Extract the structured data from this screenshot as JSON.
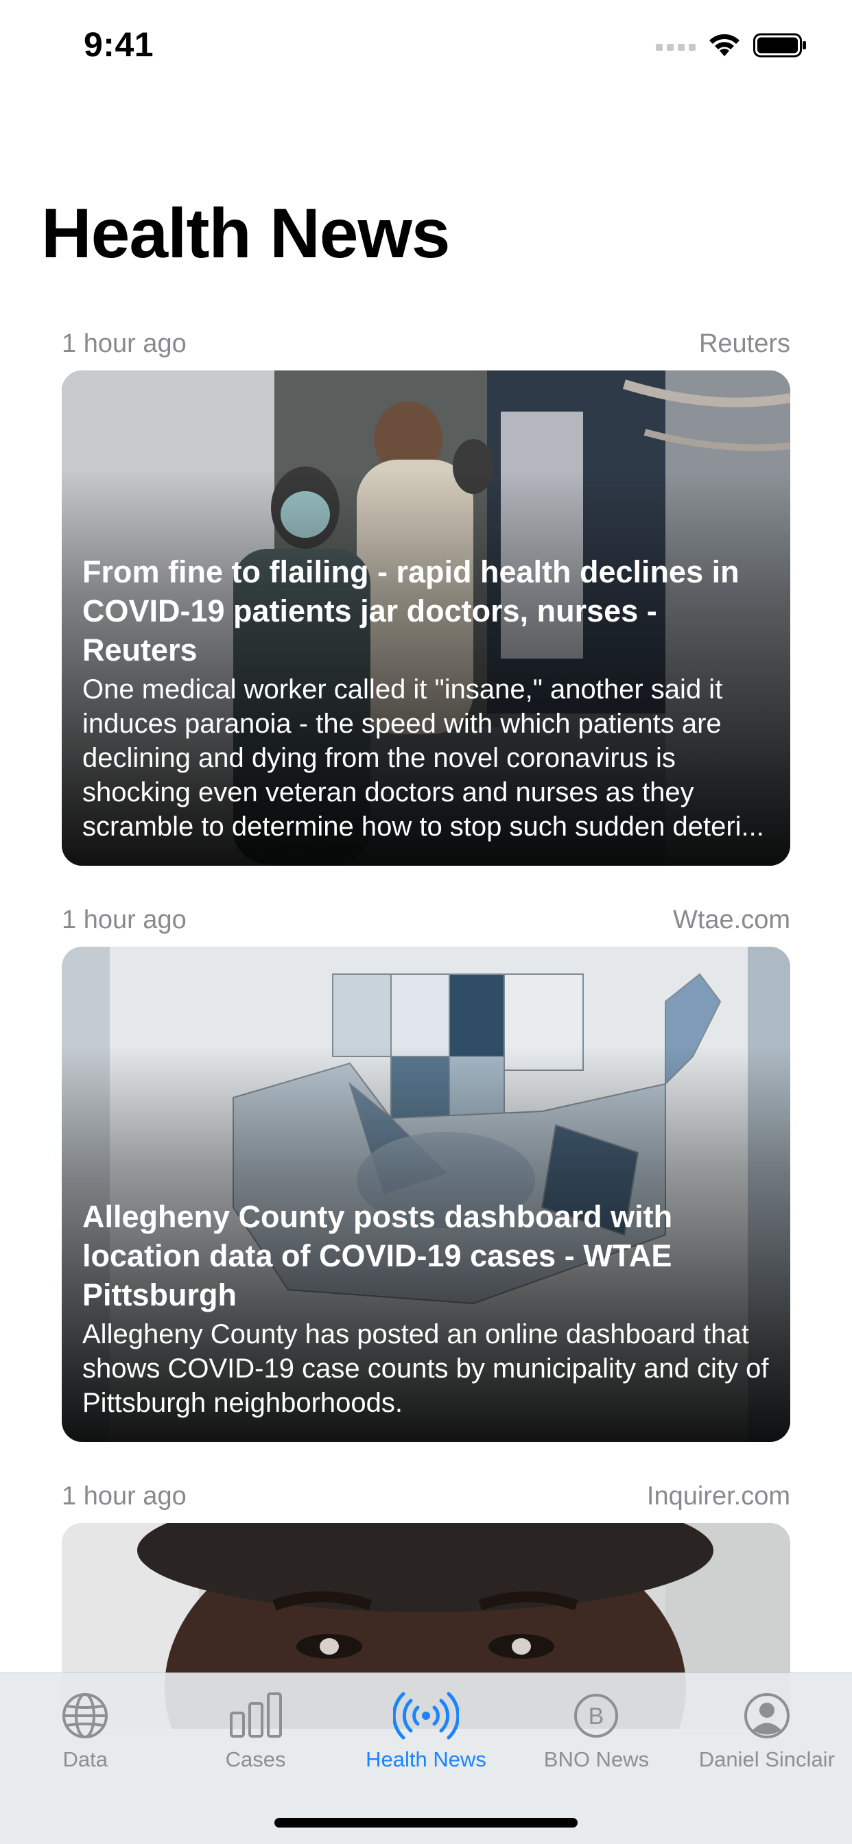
{
  "status_bar": {
    "time": "9:41"
  },
  "page": {
    "title": "Health News"
  },
  "articles": [
    {
      "time_ago": "1 hour ago",
      "source": "Reuters",
      "headline": "From fine to flailing - rapid health declines in COVID-19 patients jar doctors, nurses - Reuters",
      "summary": "One medical worker called it \"insane,\" another said it induces paranoia - the speed with which patients are declining and dying from the novel coronavirus is shocking even veteran doctors and nurses as they scramble to determine how to stop such sudden deteri..."
    },
    {
      "time_ago": "1 hour ago",
      "source": "Wtae.com",
      "headline": "Allegheny County posts dashboard with location data of COVID-19 cases - WTAE Pittsburgh",
      "summary": "Allegheny County has posted an online dashboard that shows COVID-19 case counts by municipality and city of Pittsburgh neighborhoods."
    },
    {
      "time_ago": "1 hour ago",
      "source": "Inquirer.com",
      "headline": "",
      "summary": ""
    }
  ],
  "tab_bar": {
    "tabs": [
      {
        "label": "Data",
        "icon": "globe-icon"
      },
      {
        "label": "Cases",
        "icon": "bar-chart-icon"
      },
      {
        "label": "Health News",
        "icon": "broadcast-icon",
        "active": true
      },
      {
        "label": "BNO News",
        "icon": "b-circle-icon"
      },
      {
        "label": "Daniel Sinclair",
        "icon": "person-circle-icon"
      }
    ],
    "active_color": "#1a84ff",
    "inactive_color": "#8e8e93"
  }
}
